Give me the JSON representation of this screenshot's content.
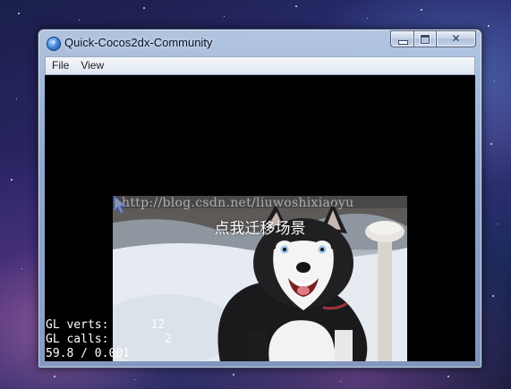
{
  "window": {
    "title": "Quick-Cocos2dx-Community",
    "app_icon": "lightning-icon",
    "buttons": {
      "minimize_icon": "minimize-icon",
      "maximize_icon": "maximize-icon",
      "close_icon": "close-icon",
      "close_glyph": "✕"
    }
  },
  "menu": {
    "items": [
      {
        "label": "File"
      },
      {
        "label": "View"
      }
    ]
  },
  "scene": {
    "watermark": "http://blog.csdn.net/liuwoshixiaoyu",
    "button_label": "点我迁移场景",
    "image": "husky-dog-photo"
  },
  "stats": {
    "verts_label": "GL verts:",
    "verts_value": "12",
    "calls_label": "GL calls:",
    "calls_value": "2",
    "fps_line": "59.8 / 0.001"
  },
  "colors": {
    "client_background": "#000000",
    "stats_text": "#ffffff"
  }
}
